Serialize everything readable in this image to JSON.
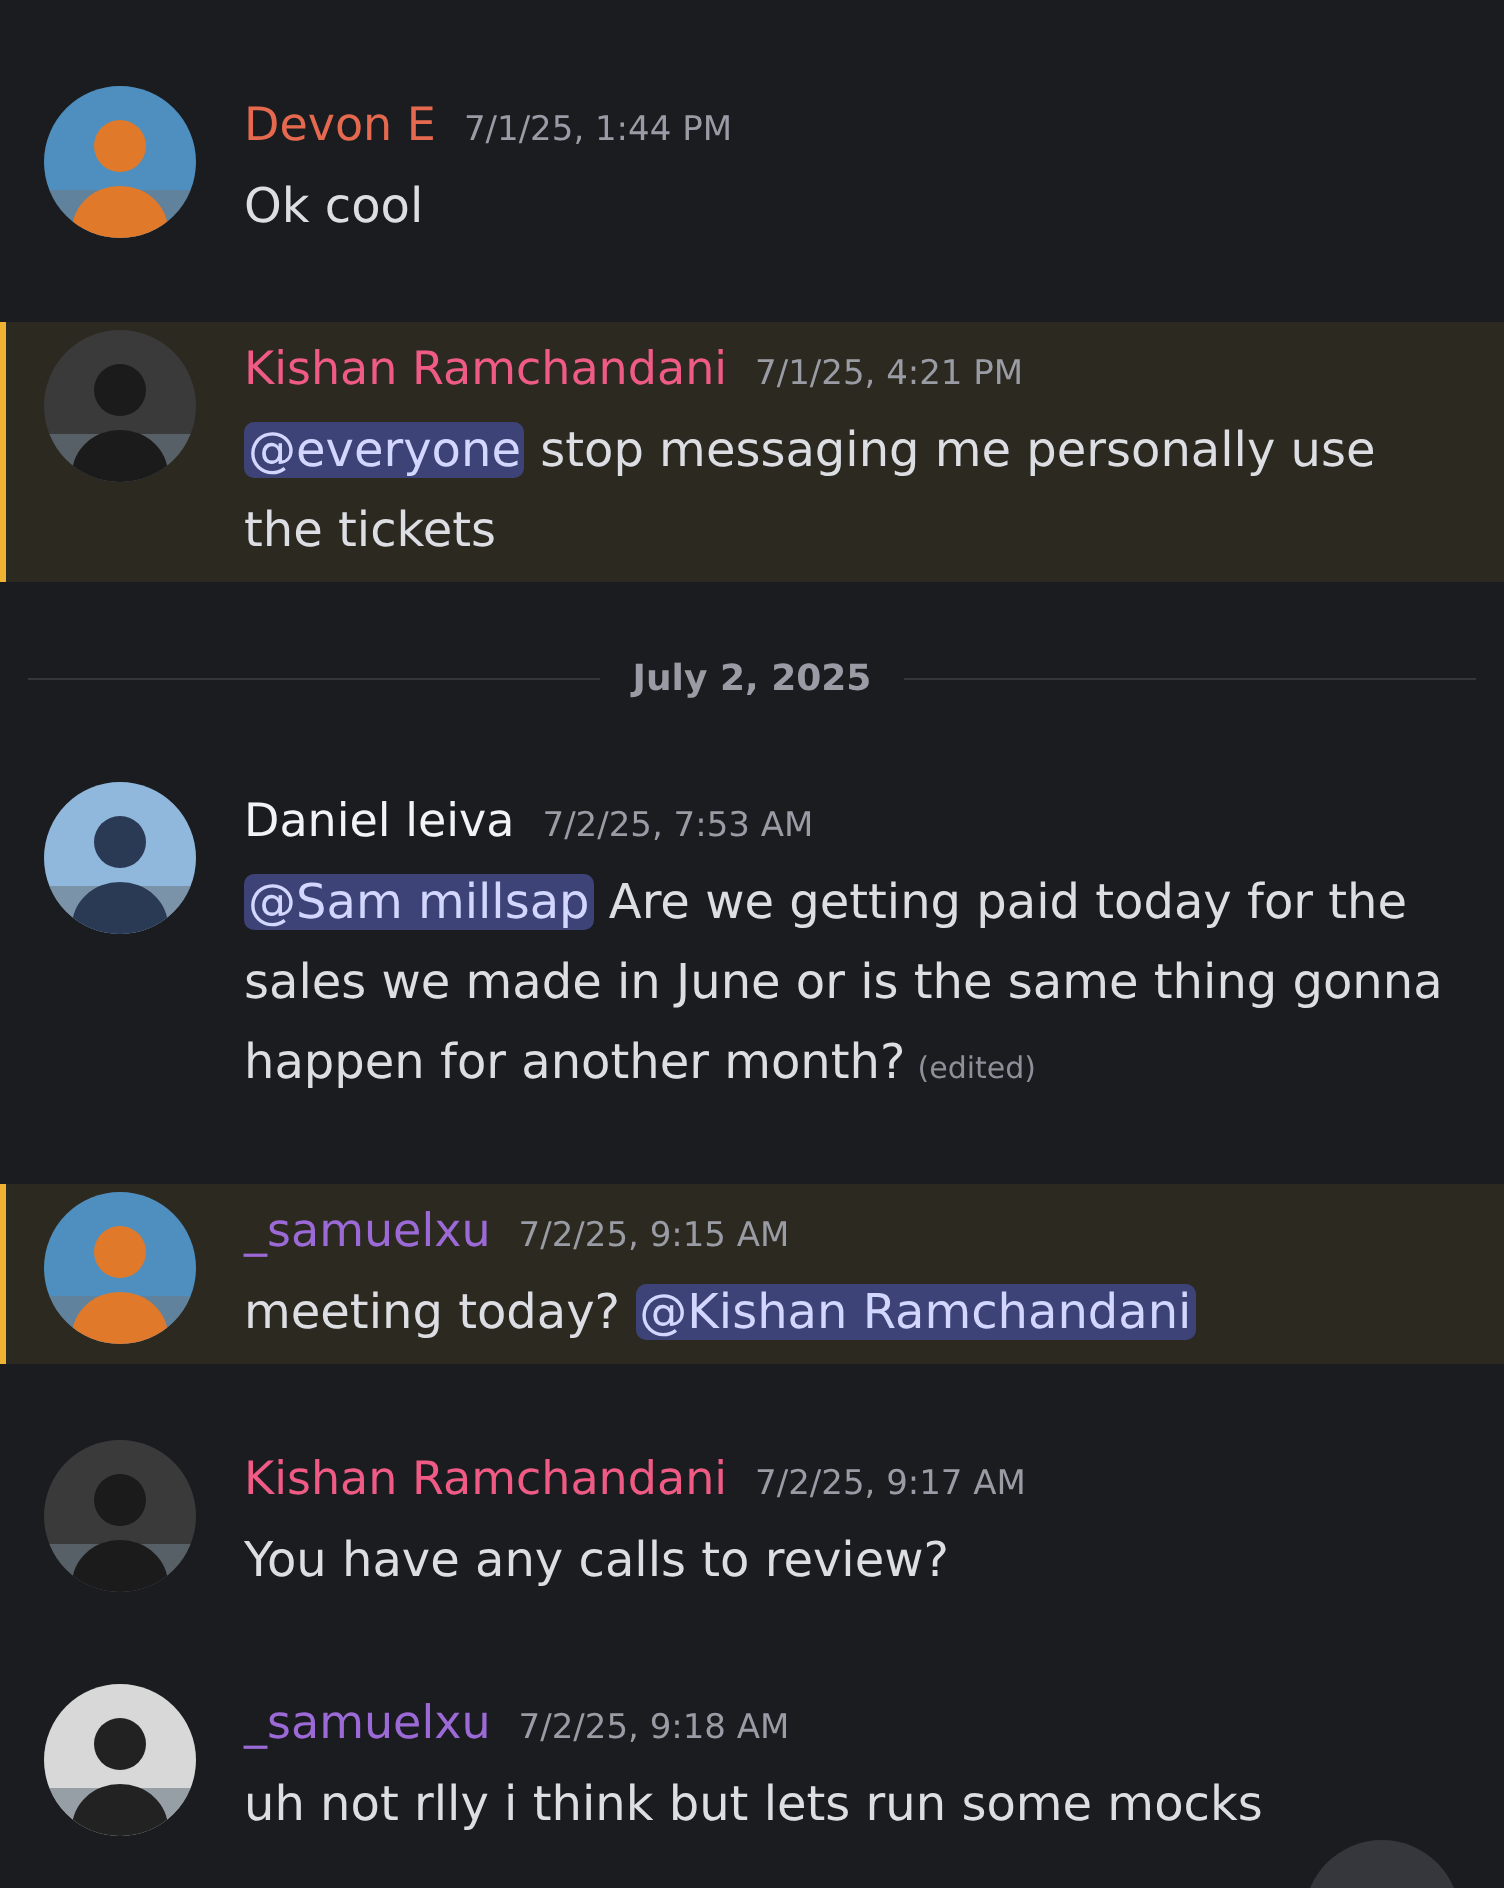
{
  "messages": [
    {
      "kind": "message",
      "author": "Devon E",
      "color": "#e5694f",
      "timestamp": "7/1/25, 1:44 PM",
      "highlighted": false,
      "content": [
        {
          "kind": "text",
          "text": "Ok cool"
        }
      ]
    },
    {
      "kind": "message",
      "author": "Kishan Ramchandani",
      "color": "#ef5b85",
      "timestamp": "7/1/25, 4:21 PM",
      "highlighted": true,
      "content": [
        {
          "kind": "mention",
          "text": "@everyone"
        },
        {
          "kind": "text",
          "text": " stop messaging me personally use the tickets"
        }
      ]
    },
    {
      "kind": "divider",
      "label": "July 2, 2025"
    },
    {
      "kind": "message",
      "author": "Daniel leiva",
      "color": "#f2f3f5",
      "timestamp": "7/2/25, 7:53 AM",
      "highlighted": false,
      "content": [
        {
          "kind": "mention",
          "text": "@Sam millsap"
        },
        {
          "kind": "text",
          "text": " Are we getting paid today for the sales we made in June or is the same thing gonna happen for another month?"
        }
      ],
      "edited": "(edited)"
    },
    {
      "kind": "message",
      "author": "_samuelxu",
      "color": "#9b6ad6",
      "timestamp": "7/2/25, 9:15 AM",
      "highlighted": true,
      "content": [
        {
          "kind": "text",
          "text": "meeting today? "
        },
        {
          "kind": "mention",
          "text": "@Kishan Ramchandani"
        }
      ]
    },
    {
      "kind": "message",
      "author": "Kishan Ramchandani",
      "color": "#ef5b85",
      "timestamp": "7/2/25, 9:17 AM",
      "highlighted": false,
      "content": [
        {
          "kind": "text",
          "text": "You have any calls to review?"
        }
      ]
    },
    {
      "kind": "message",
      "author": "_samuelxu",
      "color": "#9b6ad6",
      "timestamp": "7/2/25, 9:18 AM",
      "highlighted": false,
      "content": [
        {
          "kind": "text",
          "text": "uh not rlly i think but lets run some mocks"
        }
      ]
    }
  ]
}
